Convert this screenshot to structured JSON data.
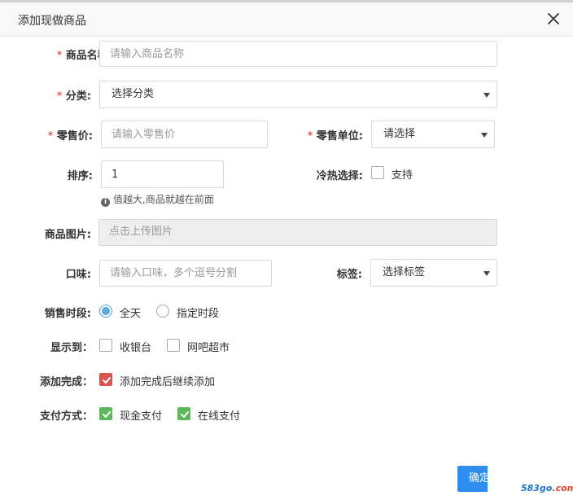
{
  "dialog": {
    "title": "添加现做商品",
    "close_glyph": "×"
  },
  "fields": {
    "name": {
      "required_mark": "*",
      "label": "商品名称:",
      "placeholder": "请输入商品名称",
      "value": ""
    },
    "category": {
      "required_mark": "*",
      "label": "分类:",
      "selected": "选择分类"
    },
    "price": {
      "required_mark": "*",
      "label": "零售价:",
      "placeholder": "请输入零售价",
      "value": ""
    },
    "unit": {
      "required_mark": "*",
      "label": "零售单位:",
      "selected": "请选择"
    },
    "sort": {
      "label": "排序:",
      "value": "1",
      "hint": "值越大,商品就越在前面"
    },
    "hotcold": {
      "label": "冷热选择:",
      "option": "支持",
      "checked": false
    },
    "image": {
      "label": "商品图片:",
      "placeholder": "点击上传图片"
    },
    "taste": {
      "label": "口味:",
      "placeholder": "请输入口味，多个逗号分割",
      "value": ""
    },
    "tag": {
      "label": "标签:",
      "selected": "选择标签"
    },
    "sale_period": {
      "label": "销售时段:",
      "options": [
        "全天",
        "指定时段"
      ],
      "selected": "全天"
    },
    "display_to": {
      "label": "显示到：",
      "options": [
        "收银台",
        "网吧超市"
      ]
    },
    "after_add": {
      "label": "添加完成：",
      "option": "添加完成后继续添加",
      "checked": true
    },
    "payment": {
      "label": "支付方式：",
      "options": [
        "现金支付",
        "在线支付"
      ],
      "checked": [
        true,
        true
      ]
    }
  },
  "footer": {
    "confirm_label": "确定"
  },
  "watermark": {
    "text_a": "583go",
    "text_b": ".com"
  },
  "colors": {
    "confirm_button": "#2e8ded",
    "checkbox_red": "#d9534f",
    "checkbox_green": "#5cb85c",
    "radio_blue": "#5aaae6",
    "required_mark": "#e02020"
  }
}
